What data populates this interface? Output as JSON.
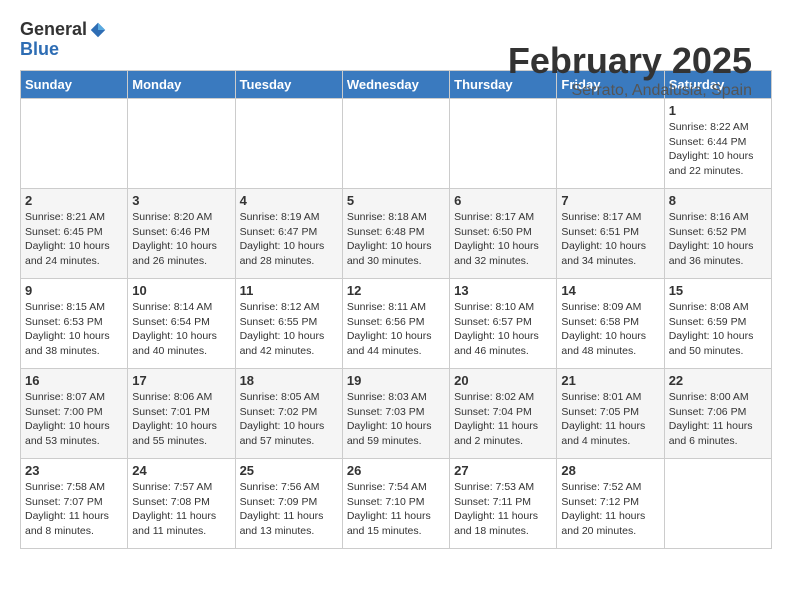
{
  "logo": {
    "general": "General",
    "blue": "Blue"
  },
  "header": {
    "title": "February 2025",
    "location": "Serrato, Andalusia, Spain"
  },
  "weekdays": [
    "Sunday",
    "Monday",
    "Tuesday",
    "Wednesday",
    "Thursday",
    "Friday",
    "Saturday"
  ],
  "weeks": [
    {
      "days": [
        {
          "num": "",
          "info": ""
        },
        {
          "num": "",
          "info": ""
        },
        {
          "num": "",
          "info": ""
        },
        {
          "num": "",
          "info": ""
        },
        {
          "num": "",
          "info": ""
        },
        {
          "num": "",
          "info": ""
        },
        {
          "num": "1",
          "info": "Sunrise: 8:22 AM\nSunset: 6:44 PM\nDaylight: 10 hours and 22 minutes."
        }
      ]
    },
    {
      "days": [
        {
          "num": "2",
          "info": "Sunrise: 8:21 AM\nSunset: 6:45 PM\nDaylight: 10 hours and 24 minutes."
        },
        {
          "num": "3",
          "info": "Sunrise: 8:20 AM\nSunset: 6:46 PM\nDaylight: 10 hours and 26 minutes."
        },
        {
          "num": "4",
          "info": "Sunrise: 8:19 AM\nSunset: 6:47 PM\nDaylight: 10 hours and 28 minutes."
        },
        {
          "num": "5",
          "info": "Sunrise: 8:18 AM\nSunset: 6:48 PM\nDaylight: 10 hours and 30 minutes."
        },
        {
          "num": "6",
          "info": "Sunrise: 8:17 AM\nSunset: 6:50 PM\nDaylight: 10 hours and 32 minutes."
        },
        {
          "num": "7",
          "info": "Sunrise: 8:17 AM\nSunset: 6:51 PM\nDaylight: 10 hours and 34 minutes."
        },
        {
          "num": "8",
          "info": "Sunrise: 8:16 AM\nSunset: 6:52 PM\nDaylight: 10 hours and 36 minutes."
        }
      ]
    },
    {
      "days": [
        {
          "num": "9",
          "info": "Sunrise: 8:15 AM\nSunset: 6:53 PM\nDaylight: 10 hours and 38 minutes."
        },
        {
          "num": "10",
          "info": "Sunrise: 8:14 AM\nSunset: 6:54 PM\nDaylight: 10 hours and 40 minutes."
        },
        {
          "num": "11",
          "info": "Sunrise: 8:12 AM\nSunset: 6:55 PM\nDaylight: 10 hours and 42 minutes."
        },
        {
          "num": "12",
          "info": "Sunrise: 8:11 AM\nSunset: 6:56 PM\nDaylight: 10 hours and 44 minutes."
        },
        {
          "num": "13",
          "info": "Sunrise: 8:10 AM\nSunset: 6:57 PM\nDaylight: 10 hours and 46 minutes."
        },
        {
          "num": "14",
          "info": "Sunrise: 8:09 AM\nSunset: 6:58 PM\nDaylight: 10 hours and 48 minutes."
        },
        {
          "num": "15",
          "info": "Sunrise: 8:08 AM\nSunset: 6:59 PM\nDaylight: 10 hours and 50 minutes."
        }
      ]
    },
    {
      "days": [
        {
          "num": "16",
          "info": "Sunrise: 8:07 AM\nSunset: 7:00 PM\nDaylight: 10 hours and 53 minutes."
        },
        {
          "num": "17",
          "info": "Sunrise: 8:06 AM\nSunset: 7:01 PM\nDaylight: 10 hours and 55 minutes."
        },
        {
          "num": "18",
          "info": "Sunrise: 8:05 AM\nSunset: 7:02 PM\nDaylight: 10 hours and 57 minutes."
        },
        {
          "num": "19",
          "info": "Sunrise: 8:03 AM\nSunset: 7:03 PM\nDaylight: 10 hours and 59 minutes."
        },
        {
          "num": "20",
          "info": "Sunrise: 8:02 AM\nSunset: 7:04 PM\nDaylight: 11 hours and 2 minutes."
        },
        {
          "num": "21",
          "info": "Sunrise: 8:01 AM\nSunset: 7:05 PM\nDaylight: 11 hours and 4 minutes."
        },
        {
          "num": "22",
          "info": "Sunrise: 8:00 AM\nSunset: 7:06 PM\nDaylight: 11 hours and 6 minutes."
        }
      ]
    },
    {
      "days": [
        {
          "num": "23",
          "info": "Sunrise: 7:58 AM\nSunset: 7:07 PM\nDaylight: 11 hours and 8 minutes."
        },
        {
          "num": "24",
          "info": "Sunrise: 7:57 AM\nSunset: 7:08 PM\nDaylight: 11 hours and 11 minutes."
        },
        {
          "num": "25",
          "info": "Sunrise: 7:56 AM\nSunset: 7:09 PM\nDaylight: 11 hours and 13 minutes."
        },
        {
          "num": "26",
          "info": "Sunrise: 7:54 AM\nSunset: 7:10 PM\nDaylight: 11 hours and 15 minutes."
        },
        {
          "num": "27",
          "info": "Sunrise: 7:53 AM\nSunset: 7:11 PM\nDaylight: 11 hours and 18 minutes."
        },
        {
          "num": "28",
          "info": "Sunrise: 7:52 AM\nSunset: 7:12 PM\nDaylight: 11 hours and 20 minutes."
        },
        {
          "num": "",
          "info": ""
        }
      ]
    }
  ]
}
